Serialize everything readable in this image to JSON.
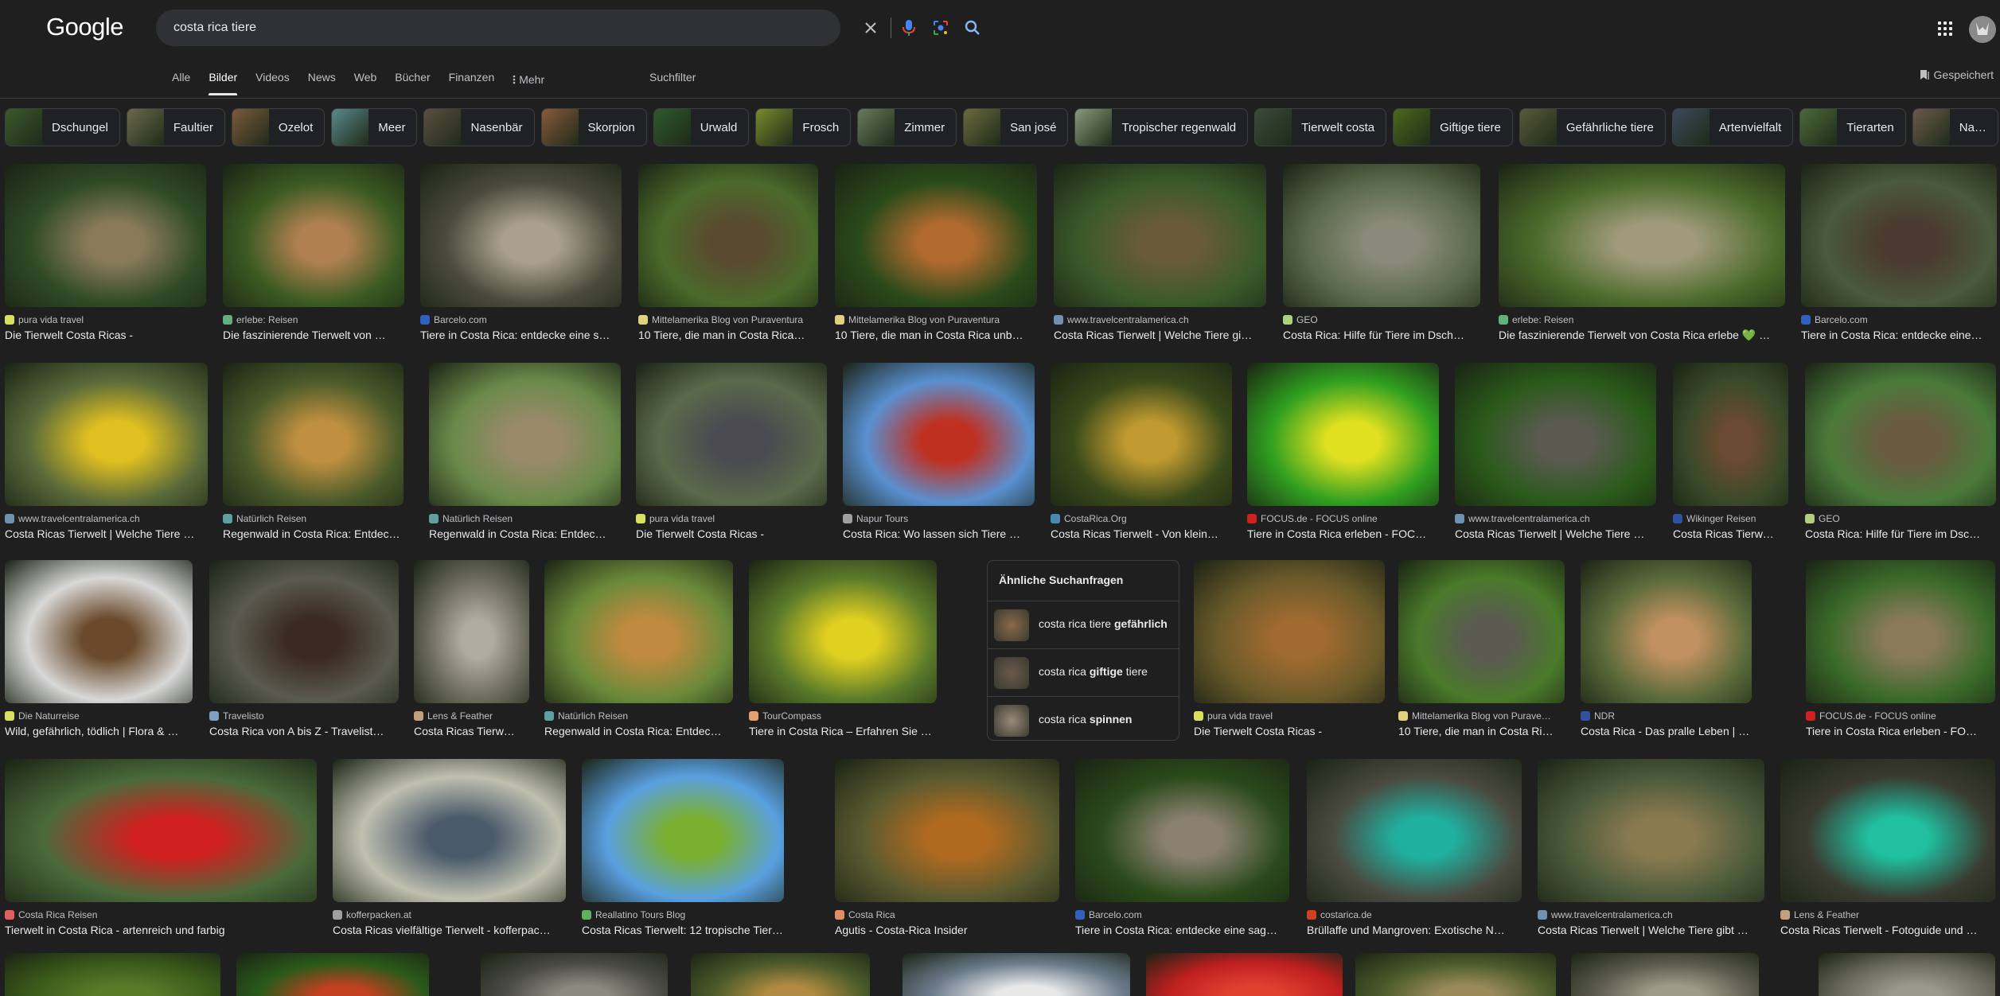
{
  "logo": "Google",
  "search": {
    "value": "costa rica tiere"
  },
  "tabs": [
    "Alle",
    "Bilder",
    "Videos",
    "News",
    "Web",
    "Bücher",
    "Finanzen"
  ],
  "more_label": "Mehr",
  "suchfilter": "Suchfilter",
  "saved_label": "Gespeichert",
  "chips": [
    {
      "label": "Dschungel",
      "color": "#3a5a2a"
    },
    {
      "label": "Faultier",
      "color": "#6b6a4a"
    },
    {
      "label": "Ozelot",
      "color": "#7a5a3a"
    },
    {
      "label": "Meer",
      "color": "#5a8a8a"
    },
    {
      "label": "Nasenbär",
      "color": "#5a5040"
    },
    {
      "label": "Skorpion",
      "color": "#8a5a3a"
    },
    {
      "label": "Urwald",
      "color": "#2e5a2a"
    },
    {
      "label": "Frosch",
      "color": "#7a8a2a"
    },
    {
      "label": "Zimmer",
      "color": "#6a7a5a"
    },
    {
      "label": "San josé",
      "color": "#6a6a3a"
    },
    {
      "label": "Tropischer regenwald",
      "color": "#8a9a7a"
    },
    {
      "label": "Tierwelt costa",
      "color": "#3a4a3a"
    },
    {
      "label": "Giftige tiere",
      "color": "#4a6a1a"
    },
    {
      "label": "Gefährliche tiere",
      "color": "#5a5a3a"
    },
    {
      "label": "Artenvielfalt",
      "color": "#3a4a5a"
    },
    {
      "label": "Tierarten",
      "color": "#4a6a3a"
    },
    {
      "label": "Na…",
      "color": "#6a5a4a"
    }
  ],
  "images": [
    {
      "source": "pura vida travel",
      "title": "Die Tierwelt Costa Ricas -",
      "colors": [
        "#2f4a26",
        "#8a7a5a"
      ],
      "fav": "#d8e060"
    },
    {
      "source": "erlebe: Reisen",
      "title": "Die faszinierende Tierwelt von …",
      "colors": [
        "#3a5a22",
        "#b08050"
      ],
      "fav": "#60b080"
    },
    {
      "source": "Barcelo.com",
      "title": "Tiere in Costa Rica: entdecke eine s…",
      "colors": [
        "#4a4a3a",
        "#aaa090"
      ],
      "fav": "#3060c0"
    },
    {
      "source": "Mittelamerika Blog von Puraventura",
      "title": "10 Tiere, die man in Costa Rica…",
      "colors": [
        "#4a6a2a",
        "#5a4a30"
      ],
      "fav": "#e0d080"
    },
    {
      "source": "Mittelamerika Blog von Puraventura",
      "title": "10 Tiere, die man in Costa Rica unb…",
      "colors": [
        "#2a4a1a",
        "#b06a30"
      ],
      "fav": "#e0d080"
    },
    {
      "source": "www.travelcentralamerica.ch",
      "title": "Costa Ricas Tierwelt | Welche Tiere gi…",
      "colors": [
        "#3a5a2a",
        "#6a5a3a"
      ],
      "fav": "#7090b0"
    },
    {
      "source": "GEO",
      "title": "Costa Rica: Hilfe für Tiere im Dsch…",
      "colors": [
        "#5a6a4a",
        "#8a8a7a"
      ],
      "fav": "#b0d080"
    },
    {
      "source": "erlebe: Reisen",
      "title": "Die faszinierende Tierwelt von Costa Rica erlebe 💚 …",
      "colors": [
        "#4a6a2a",
        "#a09a7a"
      ],
      "fav": "#60b080"
    },
    {
      "source": "Barcelo.com",
      "title": "Tiere in Costa Rica: entdecke eine…",
      "colors": [
        "#4a5a3a",
        "#4a3a30"
      ],
      "fav": "#3060c0"
    },
    {
      "source": "www.travelcentralamerica.ch",
      "title": "Costa Ricas Tierwelt | Welche Tiere …",
      "colors": [
        "#5a6a3a",
        "#e0c020"
      ],
      "fav": "#7090b0"
    },
    {
      "source": "Natürlich Reisen",
      "title": "Regenwald in Costa Rica: Entdec…",
      "colors": [
        "#4a5a2a",
        "#c09040"
      ],
      "fav": "#60a0a0"
    },
    {
      "source": "Natürlich Reisen",
      "title": "Regenwald in Costa Rica: Entdec…",
      "colors": [
        "#6a8a4a",
        "#9a8a6a"
      ],
      "fav": "#60a0a0"
    },
    {
      "source": "pura vida travel",
      "title": "Die Tierwelt Costa Ricas -",
      "colors": [
        "#5a6a4a",
        "#4a4a50"
      ],
      "fav": "#d8e060"
    },
    {
      "source": "Napur Tours",
      "title": "Costa Rica: Wo lassen sich Tiere …",
      "colors": [
        "#5a90d0",
        "#c03020"
      ],
      "fav": "#a0a0a0"
    },
    {
      "source": "CostaRica.Org",
      "title": "Costa Ricas Tierwelt - Von klein…",
      "colors": [
        "#3a4a1a",
        "#c09a30"
      ],
      "fav": "#4a8ab0"
    },
    {
      "source": "FOCUS.de - FOCUS online",
      "title": "Tiere in Costa Rica erleben - FOC…",
      "colors": [
        "#30a020",
        "#e0e020"
      ],
      "fav": "#d02020"
    },
    {
      "source": "www.travelcentralamerica.ch",
      "title": "Costa Ricas Tierwelt | Welche Tiere …",
      "colors": [
        "#2a5a1a",
        "#5a5a50"
      ],
      "fav": "#7090b0"
    },
    {
      "source": "Wikinger Reisen",
      "title": "Costa Ricas Tierw…",
      "colors": [
        "#3a4a2a",
        "#6a4a30"
      ],
      "fav": "#3050a0"
    },
    {
      "source": "GEO",
      "title": "Costa Rica: Hilfe für Tiere im Dsc…",
      "colors": [
        "#4a7a3a",
        "#6a5a40"
      ],
      "fav": "#b0d080"
    },
    {
      "source": "Die Naturreise",
      "title": "Wild, gefährlich, tödlich | Flora & …",
      "colors": [
        "#d8d8d8",
        "#6a4a2a"
      ],
      "fav": "#d8e060"
    },
    {
      "source": "Travelisto",
      "title": "Costa Rica von A bis Z - Travelist…",
      "colors": [
        "#5a5a50",
        "#3a2a20"
      ],
      "fav": "#80a0c0"
    },
    {
      "source": "Lens & Feather",
      "title": "Costa Ricas Tierw…",
      "colors": [
        "#6a6a5a",
        "#b0aaa0"
      ],
      "fav": "#c0a080"
    },
    {
      "source": "Natürlich Reisen",
      "title": "Regenwald in Costa Rica: Entdec…",
      "colors": [
        "#6a8a3a",
        "#c08a40"
      ],
      "fav": "#60a0a0"
    },
    {
      "source": "TourCompass",
      "title": "Tiere in Costa Rica – Erfahren Sie hier …",
      "colors": [
        "#5a7a2a",
        "#e0d020"
      ],
      "fav": "#e0a070"
    },
    {
      "source": "pura vida travel",
      "title": "Die Tierwelt Costa Ricas -",
      "colors": [
        "#6a5a2a",
        "#a06a30"
      ],
      "fav": "#d8e060"
    },
    {
      "source": "Mittelamerika Blog von Purave…",
      "title": "10 Tiere, die man in Costa Ri…",
      "colors": [
        "#4a7a2a",
        "#5a5a50"
      ],
      "fav": "#e0d080"
    },
    {
      "source": "NDR",
      "title": "Costa Rica - Das pralle Leben | NDR…",
      "colors": [
        "#5a6a3a",
        "#c09060"
      ],
      "fav": "#3050a0"
    },
    {
      "source": "FOCUS.de - FOCUS online",
      "title": "Tiere in Costa Rica erleben - FO…",
      "colors": [
        "#3a6a2a",
        "#8a7a5a"
      ],
      "fav": "#d02020"
    },
    {
      "source": "Costa Rica Reisen",
      "title": "Tierwelt in Costa Rica - artenreich und farbig",
      "colors": [
        "#4a6a3a",
        "#d02020"
      ],
      "fav": "#e06060"
    },
    {
      "source": "kofferpacken.at",
      "title": "Costa Ricas vielfältige Tierwelt - kofferpac…",
      "colors": [
        "#c0c0b0",
        "#4a5a6a"
      ],
      "fav": "#a0a0a0"
    },
    {
      "source": "Reallatino Tours Blog",
      "title": "Costa Ricas Tierwelt: 12 tropische Tiere zu…",
      "colors": [
        "#5aa0e0",
        "#7ab030"
      ],
      "fav": "#60b060"
    },
    {
      "source": "Costa Rica",
      "title": "Agutis - Costa-Rica Insider",
      "colors": [
        "#5a5a30",
        "#b06a20"
      ],
      "fav": "#e09060"
    },
    {
      "source": "Barcelo.com",
      "title": "Tiere in Costa Rica: entdecke eine sag…",
      "colors": [
        "#2a4a1a",
        "#8a8070"
      ],
      "fav": "#3060c0"
    },
    {
      "source": "costarica.de",
      "title": "Brüllaffe und Mangroven: Exotische N…",
      "colors": [
        "#4a4a40",
        "#20b0a0"
      ],
      "fav": "#d04020"
    },
    {
      "source": "www.travelcentralamerica.ch",
      "title": "Costa Ricas Tierwelt | Welche Tiere gibt …",
      "colors": [
        "#4a5a3a",
        "#8a7a50"
      ],
      "fav": "#7090b0"
    },
    {
      "source": "Lens & Feather",
      "title": "Costa Ricas Tierwelt - Fotoguide und …",
      "colors": [
        "#3a3a30",
        "#20c0a0"
      ],
      "fav": "#c0a080"
    },
    {
      "source": "",
      "title": "",
      "colors": [
        "#3a5a1a",
        "#5a7a2a"
      ],
      "fav": "#000000"
    },
    {
      "source": "",
      "title": "",
      "colors": [
        "#2a5a1a",
        "#c04020"
      ],
      "fav": "#000000"
    },
    {
      "source": "",
      "title": "",
      "colors": [
        "#4a4a44",
        "#8a8a80"
      ],
      "fav": "#000000"
    },
    {
      "source": "",
      "title": "",
      "colors": [
        "#4a5a2a",
        "#b08a40"
      ],
      "fav": "#000000"
    },
    {
      "source": "",
      "title": "",
      "colors": [
        "#6a7a8a",
        "#e8e8e8"
      ],
      "fav": "#000000"
    },
    {
      "source": "",
      "title": "",
      "colors": [
        "#c02020",
        "#e04030"
      ],
      "fav": "#000000"
    },
    {
      "source": "",
      "title": "",
      "colors": [
        "#4a5a2a",
        "#9a8a5a"
      ],
      "fav": "#000000"
    },
    {
      "source": "",
      "title": "",
      "colors": [
        "#5a5a4a",
        "#a09a8a"
      ],
      "fav": "#000000"
    },
    {
      "source": "",
      "title": "",
      "colors": [
        "#6a6a5a",
        "#9a9a8a"
      ],
      "fav": "#000000"
    }
  ],
  "related": {
    "title": "Ähnliche Suchanfragen",
    "items": [
      {
        "prefix": "costa rica tiere ",
        "bold": "gefährlich",
        "suffix": "",
        "color": "#8a6a4a"
      },
      {
        "prefix": "costa rica ",
        "bold": "giftige",
        "suffix": " tiere",
        "color": "#6a5a4a"
      },
      {
        "prefix": "costa rica ",
        "bold": "spinnen",
        "suffix": "",
        "color": "#9a8a7a"
      }
    ]
  }
}
